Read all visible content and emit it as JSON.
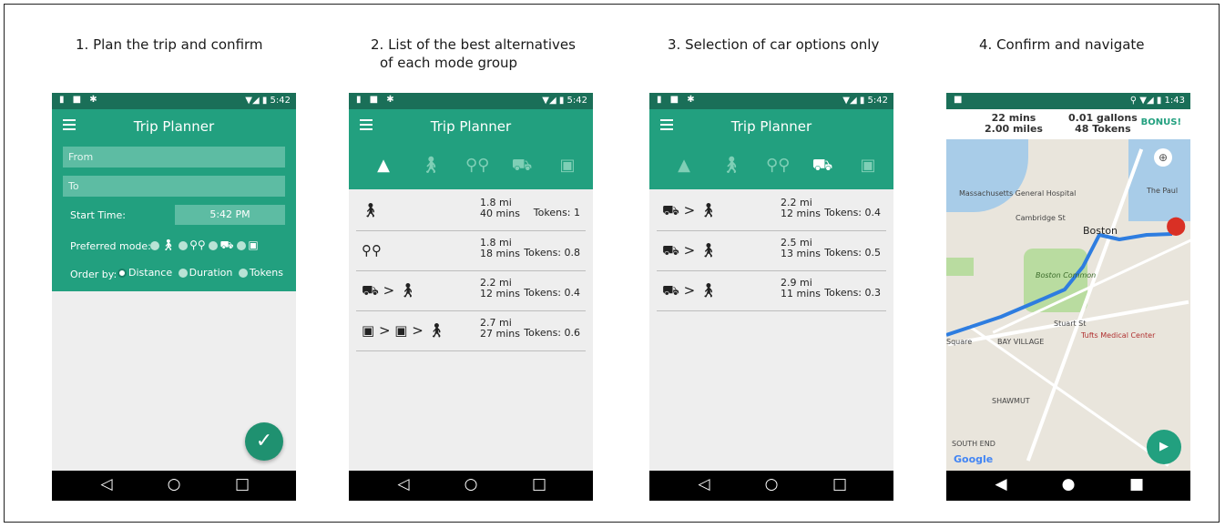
{
  "captions": {
    "s1": "1. Plan the trip and confirm",
    "s2_line1": "2. List of the best alternatives",
    "s2_line2": "of each mode group",
    "s3": "3. Selection of car options only",
    "s4": "4. Confirm and navigate"
  },
  "status": {
    "time_a": "5:42",
    "time_b": "1:43"
  },
  "app": {
    "title": "Trip Planner"
  },
  "form": {
    "from_placeholder": "From",
    "to_placeholder": "To",
    "start_time_label": "Start Time:",
    "start_time_value": "5:42 PM",
    "preferred_mode_label": "Preferred mode:",
    "order_by_label": "Order by:",
    "order_options": [
      "Distance",
      "Duration",
      "Tokens"
    ],
    "order_selected": "Distance"
  },
  "alternatives": [
    {
      "icon": "walk",
      "distance": "1.8 mi",
      "duration": "40 mins",
      "tokens": "Tokens: 1"
    },
    {
      "icon": "bike",
      "distance": "1.8 mi",
      "duration": "18 mins",
      "tokens": "Tokens: 0.8"
    },
    {
      "icon": "car > walk",
      "distance": "2.2 mi",
      "duration": "12 mins",
      "tokens": "Tokens: 0.4"
    },
    {
      "icon": "transit > transit > walk",
      "distance": "2.7 mi",
      "duration": "27 mins",
      "tokens": "Tokens: 0.6"
    }
  ],
  "car_options": [
    {
      "icon": "car > walk",
      "distance": "2.2 mi",
      "duration": "12 mins",
      "tokens": "Tokens: 0.4"
    },
    {
      "icon": "car > walk",
      "distance": "2.5 mi",
      "duration": "13 mins",
      "tokens": "Tokens: 0.5"
    },
    {
      "icon": "car > walk",
      "distance": "2.9 mi",
      "duration": "11 mins",
      "tokens": "Tokens: 0.3"
    }
  ],
  "navigation": {
    "duration": "22 mins",
    "distance": "2.00 miles",
    "fuel": "0.01 gallons",
    "tokens": "48 Tokens",
    "bonus": "BONUS!",
    "map_labels": {
      "hospital": "Massachusetts General Hospital",
      "boston": "Boston",
      "common": "Boston Common",
      "bay_village": "BAY VILLAGE",
      "tufts": "Tufts Medical Center",
      "shawmut": "SHAWMUT",
      "south_end": "SOUTH END",
      "google": "Google",
      "cambridge_st": "Cambridge St",
      "stuart_st": "Stuart St",
      "square": "Square",
      "paul": "The Paul"
    }
  },
  "colors": {
    "primary": "#22a07f",
    "dark": "#1a6f58",
    "accent_route": "#2e7de0",
    "bonus": "#22a07f"
  }
}
